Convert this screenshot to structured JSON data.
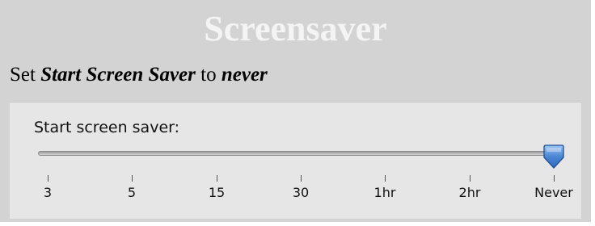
{
  "header": {
    "title": "Screensaver"
  },
  "instruction": {
    "prefix": "Set ",
    "setting": "Start Screen Saver",
    "middle": " to ",
    "value": "never"
  },
  "panel": {
    "label": "Start screen saver:",
    "slider": {
      "ticks": [
        "3",
        "5",
        "15",
        "30",
        "1hr",
        "2hr",
        "Never"
      ],
      "selected_value": "Never",
      "selected_index": 6,
      "thumb_color": "#4a86d4"
    }
  }
}
